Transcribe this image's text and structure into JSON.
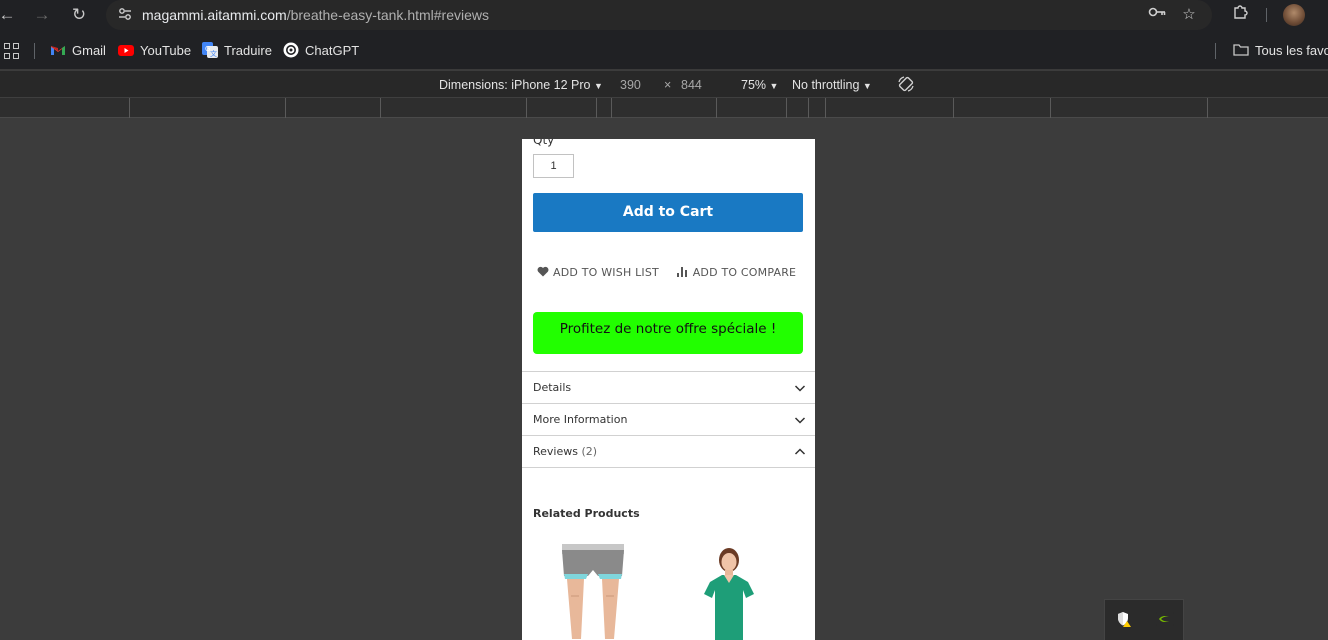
{
  "browser": {
    "url_host": "magammi.aitammi.com",
    "url_path": "/breathe-easy-tank.html#reviews"
  },
  "bookmarks": {
    "items": [
      {
        "label": "Gmail",
        "icon": "gmail-icon",
        "color": "#ea4335"
      },
      {
        "label": "YouTube",
        "icon": "youtube-icon",
        "color": "#ff0000"
      },
      {
        "label": "Traduire",
        "icon": "translate-icon",
        "color": "#4285f4"
      },
      {
        "label": "ChatGPT",
        "icon": "chatgpt-icon",
        "color": "#ffffff"
      }
    ],
    "all_bookmarks": "Tous les favoris"
  },
  "devtools": {
    "dimensions_label": "Dimensions: iPhone 12 Pro",
    "width": "390",
    "times": "×",
    "height": "844",
    "zoom": "75%",
    "throttling": "No throttling"
  },
  "product": {
    "qty_label": "Qty",
    "qty_value": "1",
    "add_to_cart": "Add to Cart",
    "wishlist": "ADD TO WISH LIST",
    "compare": "ADD TO COMPARE",
    "offer": "Profitez de notre offre spéciale !",
    "offer_color": "#22ff00",
    "cart_color": "#1979c3",
    "tabs": [
      {
        "label": "Details",
        "count": "",
        "expanded": false
      },
      {
        "label": "More Information",
        "count": "",
        "expanded": false
      },
      {
        "label": "Reviews",
        "count": "(2)",
        "expanded": true
      }
    ],
    "related_title": "Related Products"
  }
}
